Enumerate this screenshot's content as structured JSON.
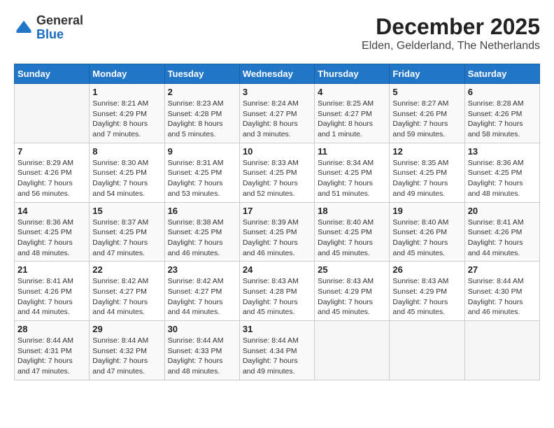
{
  "logo": {
    "general": "General",
    "blue": "Blue"
  },
  "title": "December 2025",
  "location": "Elden, Gelderland, The Netherlands",
  "weekdays": [
    "Sunday",
    "Monday",
    "Tuesday",
    "Wednesday",
    "Thursday",
    "Friday",
    "Saturday"
  ],
  "weeks": [
    [
      {
        "day": "",
        "sunrise": "",
        "sunset": "",
        "daylight": ""
      },
      {
        "day": "1",
        "sunrise": "Sunrise: 8:21 AM",
        "sunset": "Sunset: 4:29 PM",
        "daylight": "Daylight: 8 hours and 7 minutes."
      },
      {
        "day": "2",
        "sunrise": "Sunrise: 8:23 AM",
        "sunset": "Sunset: 4:28 PM",
        "daylight": "Daylight: 8 hours and 5 minutes."
      },
      {
        "day": "3",
        "sunrise": "Sunrise: 8:24 AM",
        "sunset": "Sunset: 4:27 PM",
        "daylight": "Daylight: 8 hours and 3 minutes."
      },
      {
        "day": "4",
        "sunrise": "Sunrise: 8:25 AM",
        "sunset": "Sunset: 4:27 PM",
        "daylight": "Daylight: 8 hours and 1 minute."
      },
      {
        "day": "5",
        "sunrise": "Sunrise: 8:27 AM",
        "sunset": "Sunset: 4:26 PM",
        "daylight": "Daylight: 7 hours and 59 minutes."
      },
      {
        "day": "6",
        "sunrise": "Sunrise: 8:28 AM",
        "sunset": "Sunset: 4:26 PM",
        "daylight": "Daylight: 7 hours and 58 minutes."
      }
    ],
    [
      {
        "day": "7",
        "sunrise": "Sunrise: 8:29 AM",
        "sunset": "Sunset: 4:26 PM",
        "daylight": "Daylight: 7 hours and 56 minutes."
      },
      {
        "day": "8",
        "sunrise": "Sunrise: 8:30 AM",
        "sunset": "Sunset: 4:25 PM",
        "daylight": "Daylight: 7 hours and 54 minutes."
      },
      {
        "day": "9",
        "sunrise": "Sunrise: 8:31 AM",
        "sunset": "Sunset: 4:25 PM",
        "daylight": "Daylight: 7 hours and 53 minutes."
      },
      {
        "day": "10",
        "sunrise": "Sunrise: 8:33 AM",
        "sunset": "Sunset: 4:25 PM",
        "daylight": "Daylight: 7 hours and 52 minutes."
      },
      {
        "day": "11",
        "sunrise": "Sunrise: 8:34 AM",
        "sunset": "Sunset: 4:25 PM",
        "daylight": "Daylight: 7 hours and 51 minutes."
      },
      {
        "day": "12",
        "sunrise": "Sunrise: 8:35 AM",
        "sunset": "Sunset: 4:25 PM",
        "daylight": "Daylight: 7 hours and 49 minutes."
      },
      {
        "day": "13",
        "sunrise": "Sunrise: 8:36 AM",
        "sunset": "Sunset: 4:25 PM",
        "daylight": "Daylight: 7 hours and 48 minutes."
      }
    ],
    [
      {
        "day": "14",
        "sunrise": "Sunrise: 8:36 AM",
        "sunset": "Sunset: 4:25 PM",
        "daylight": "Daylight: 7 hours and 48 minutes."
      },
      {
        "day": "15",
        "sunrise": "Sunrise: 8:37 AM",
        "sunset": "Sunset: 4:25 PM",
        "daylight": "Daylight: 7 hours and 47 minutes."
      },
      {
        "day": "16",
        "sunrise": "Sunrise: 8:38 AM",
        "sunset": "Sunset: 4:25 PM",
        "daylight": "Daylight: 7 hours and 46 minutes."
      },
      {
        "day": "17",
        "sunrise": "Sunrise: 8:39 AM",
        "sunset": "Sunset: 4:25 PM",
        "daylight": "Daylight: 7 hours and 46 minutes."
      },
      {
        "day": "18",
        "sunrise": "Sunrise: 8:40 AM",
        "sunset": "Sunset: 4:25 PM",
        "daylight": "Daylight: 7 hours and 45 minutes."
      },
      {
        "day": "19",
        "sunrise": "Sunrise: 8:40 AM",
        "sunset": "Sunset: 4:26 PM",
        "daylight": "Daylight: 7 hours and 45 minutes."
      },
      {
        "day": "20",
        "sunrise": "Sunrise: 8:41 AM",
        "sunset": "Sunset: 4:26 PM",
        "daylight": "Daylight: 7 hours and 44 minutes."
      }
    ],
    [
      {
        "day": "21",
        "sunrise": "Sunrise: 8:41 AM",
        "sunset": "Sunset: 4:26 PM",
        "daylight": "Daylight: 7 hours and 44 minutes."
      },
      {
        "day": "22",
        "sunrise": "Sunrise: 8:42 AM",
        "sunset": "Sunset: 4:27 PM",
        "daylight": "Daylight: 7 hours and 44 minutes."
      },
      {
        "day": "23",
        "sunrise": "Sunrise: 8:42 AM",
        "sunset": "Sunset: 4:27 PM",
        "daylight": "Daylight: 7 hours and 44 minutes."
      },
      {
        "day": "24",
        "sunrise": "Sunrise: 8:43 AM",
        "sunset": "Sunset: 4:28 PM",
        "daylight": "Daylight: 7 hours and 45 minutes."
      },
      {
        "day": "25",
        "sunrise": "Sunrise: 8:43 AM",
        "sunset": "Sunset: 4:29 PM",
        "daylight": "Daylight: 7 hours and 45 minutes."
      },
      {
        "day": "26",
        "sunrise": "Sunrise: 8:43 AM",
        "sunset": "Sunset: 4:29 PM",
        "daylight": "Daylight: 7 hours and 45 minutes."
      },
      {
        "day": "27",
        "sunrise": "Sunrise: 8:44 AM",
        "sunset": "Sunset: 4:30 PM",
        "daylight": "Daylight: 7 hours and 46 minutes."
      }
    ],
    [
      {
        "day": "28",
        "sunrise": "Sunrise: 8:44 AM",
        "sunset": "Sunset: 4:31 PM",
        "daylight": "Daylight: 7 hours and 47 minutes."
      },
      {
        "day": "29",
        "sunrise": "Sunrise: 8:44 AM",
        "sunset": "Sunset: 4:32 PM",
        "daylight": "Daylight: 7 hours and 47 minutes."
      },
      {
        "day": "30",
        "sunrise": "Sunrise: 8:44 AM",
        "sunset": "Sunset: 4:33 PM",
        "daylight": "Daylight: 7 hours and 48 minutes."
      },
      {
        "day": "31",
        "sunrise": "Sunrise: 8:44 AM",
        "sunset": "Sunset: 4:34 PM",
        "daylight": "Daylight: 7 hours and 49 minutes."
      },
      {
        "day": "",
        "sunrise": "",
        "sunset": "",
        "daylight": ""
      },
      {
        "day": "",
        "sunrise": "",
        "sunset": "",
        "daylight": ""
      },
      {
        "day": "",
        "sunrise": "",
        "sunset": "",
        "daylight": ""
      }
    ]
  ]
}
